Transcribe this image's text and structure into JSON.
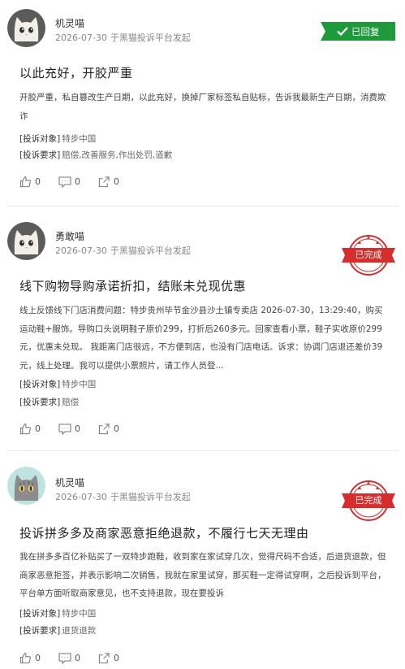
{
  "complaints": [
    {
      "username": "机灵喵",
      "date": "2026-07-30",
      "source": "于黑猫投诉平台发起",
      "status_label": "已回复",
      "title": "以此充好，开胶严重",
      "body": "开胶严重，私自篡改生产日期，以此充好，换掉厂家标签私自贴标，告诉我最新生产日期，消费欺诈",
      "target_label": "[投诉对象]",
      "target_value": "特步中国",
      "demand_label": "[投诉要求]",
      "demand_value": "赔偿,改善服务,作出处罚,道歉",
      "likes": "0",
      "comments": "0",
      "shares": "0"
    },
    {
      "username": "勇敢喵",
      "date": "2026-07-30",
      "source": "于黑猫投诉平台发起",
      "status_label": "已完成",
      "title": "线下购物导购承诺折扣，结账未兑现优惠",
      "body": "线上反馈线下门店消费问题：特步贵州毕节金沙县沙土镇专卖店 2026-07-30，13:29:40，购买运动鞋+服饰。导购口头说明鞋子原价299，打折后260多元。回家查看小票，鞋子实收原价299元，优惠未兑现。 我距离门店很远，不方便到店，也没有门店电话。诉求：协调门店退还差价39元，线上处理。我可以提供小票照片，请工作人员登...",
      "target_label": "[投诉对象]",
      "target_value": "特步中国",
      "demand_label": "[投诉要求]",
      "demand_value": "赔偿",
      "likes": "0",
      "comments": "0",
      "shares": "0"
    },
    {
      "username": "机灵喵",
      "date": "2026-07-30",
      "source": "于黑猫投诉平台发起",
      "status_label": "已完成",
      "title": "投诉拼多多及商家恶意拒绝退款，不履行七天无理由",
      "body": "我在拼多多百亿补贴买了一双特步跑鞋，收到家在家试穿几次，觉得尺码不合适，后退货退款，但商家恶意拒签，并表示影响二次销售，我就在家里试穿，那买鞋一定得试穿啊，之后投诉到平台，平台单方面听取商家意见，也不支持退款，现在要投诉",
      "target_label": "[投诉对象]",
      "target_value": "特步中国",
      "demand_label": "[投诉要求]",
      "demand_value": "退货退款",
      "likes": "0",
      "comments": "0",
      "shares": "0"
    }
  ],
  "colors": {
    "replied_badge": "#1e9a3c",
    "completed_stamp": "#d62d2d"
  }
}
